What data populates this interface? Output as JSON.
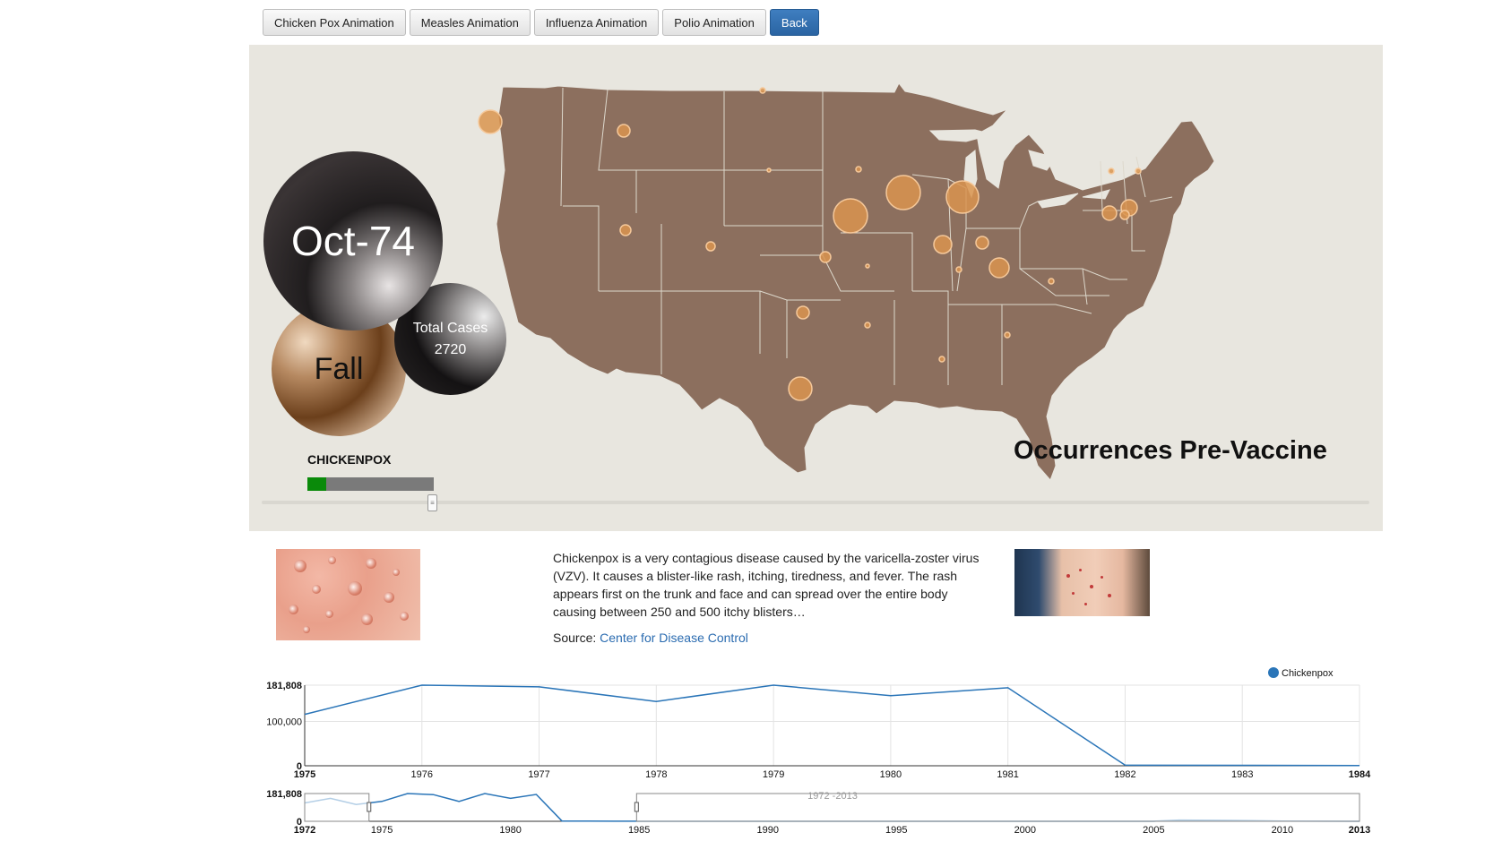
{
  "toolbar": {
    "buttons": [
      {
        "label": "Chicken Pox Animation"
      },
      {
        "label": "Measles Animation"
      },
      {
        "label": "Influenza Animation"
      },
      {
        "label": "Polio Animation"
      },
      {
        "label": "Back"
      }
    ]
  },
  "map_panel": {
    "date": "Oct-74",
    "season": "Fall",
    "total_label": "Total Cases",
    "total_value": "2720",
    "disease": "CHICKENPOX",
    "progress_fraction": 0.15,
    "title": "Occurrences Pre-Vaccine"
  },
  "info": {
    "description": "Chickenpox is a very contagious disease caused by the varicella-zoster virus (VZV). It causes a blister-like rash, itching, tiredness, and fever. The rash appears first on the trunk and face and can spread over the entire body causing between 250 and 500 itchy blisters…",
    "source_label": "Source:",
    "source_link": "Center for Disease Control"
  },
  "colors": {
    "map_land": "#8c6f5e",
    "bubble": "#d9944f",
    "line": "#2a75b8",
    "accent_button": "#2f6aa8"
  },
  "chart_data": [
    {
      "type": "line",
      "legend": "Chickenpox",
      "x": [
        1975,
        1976,
        1977,
        1978,
        1979,
        1980,
        1981,
        1982,
        1983,
        1984
      ],
      "series": [
        {
          "name": "Chickenpox",
          "values": [
            116000,
            181808,
            178000,
            145000,
            181808,
            158000,
            176000,
            1500,
            1000,
            500
          ]
        }
      ],
      "xlim": [
        1975,
        1984
      ],
      "ylim": [
        0,
        181808
      ],
      "y_ticks": [
        "181,808",
        "100,000",
        "0"
      ],
      "x_ticks": [
        "1975",
        "1976",
        "1977",
        "1978",
        "1979",
        "1980",
        "1981",
        "1982",
        "1983",
        "1984"
      ]
    },
    {
      "type": "line",
      "brush_label": "1972 -2013",
      "x": [
        1972,
        1973,
        1974,
        1975,
        1976,
        1977,
        1978,
        1979,
        1980,
        1981,
        1982,
        1983,
        1984,
        1990,
        2000,
        2005,
        2006,
        2008,
        2010,
        2013
      ],
      "series": [
        {
          "name": "Chickenpox",
          "values": [
            120000,
            150000,
            110000,
            130000,
            181808,
            175000,
            130000,
            181808,
            150000,
            176000,
            1500,
            1000,
            500,
            300,
            300,
            300,
            8000,
            6000,
            2000,
            500
          ]
        }
      ],
      "xlim": [
        1972,
        2013
      ],
      "ylim": [
        0,
        181808
      ],
      "y_ticks": [
        "181,808",
        "0"
      ],
      "x_ticks": [
        "1972",
        "1975",
        "1980",
        "1985",
        "1990",
        "1995",
        "2000",
        "2005",
        "2010",
        "2013"
      ]
    }
  ]
}
